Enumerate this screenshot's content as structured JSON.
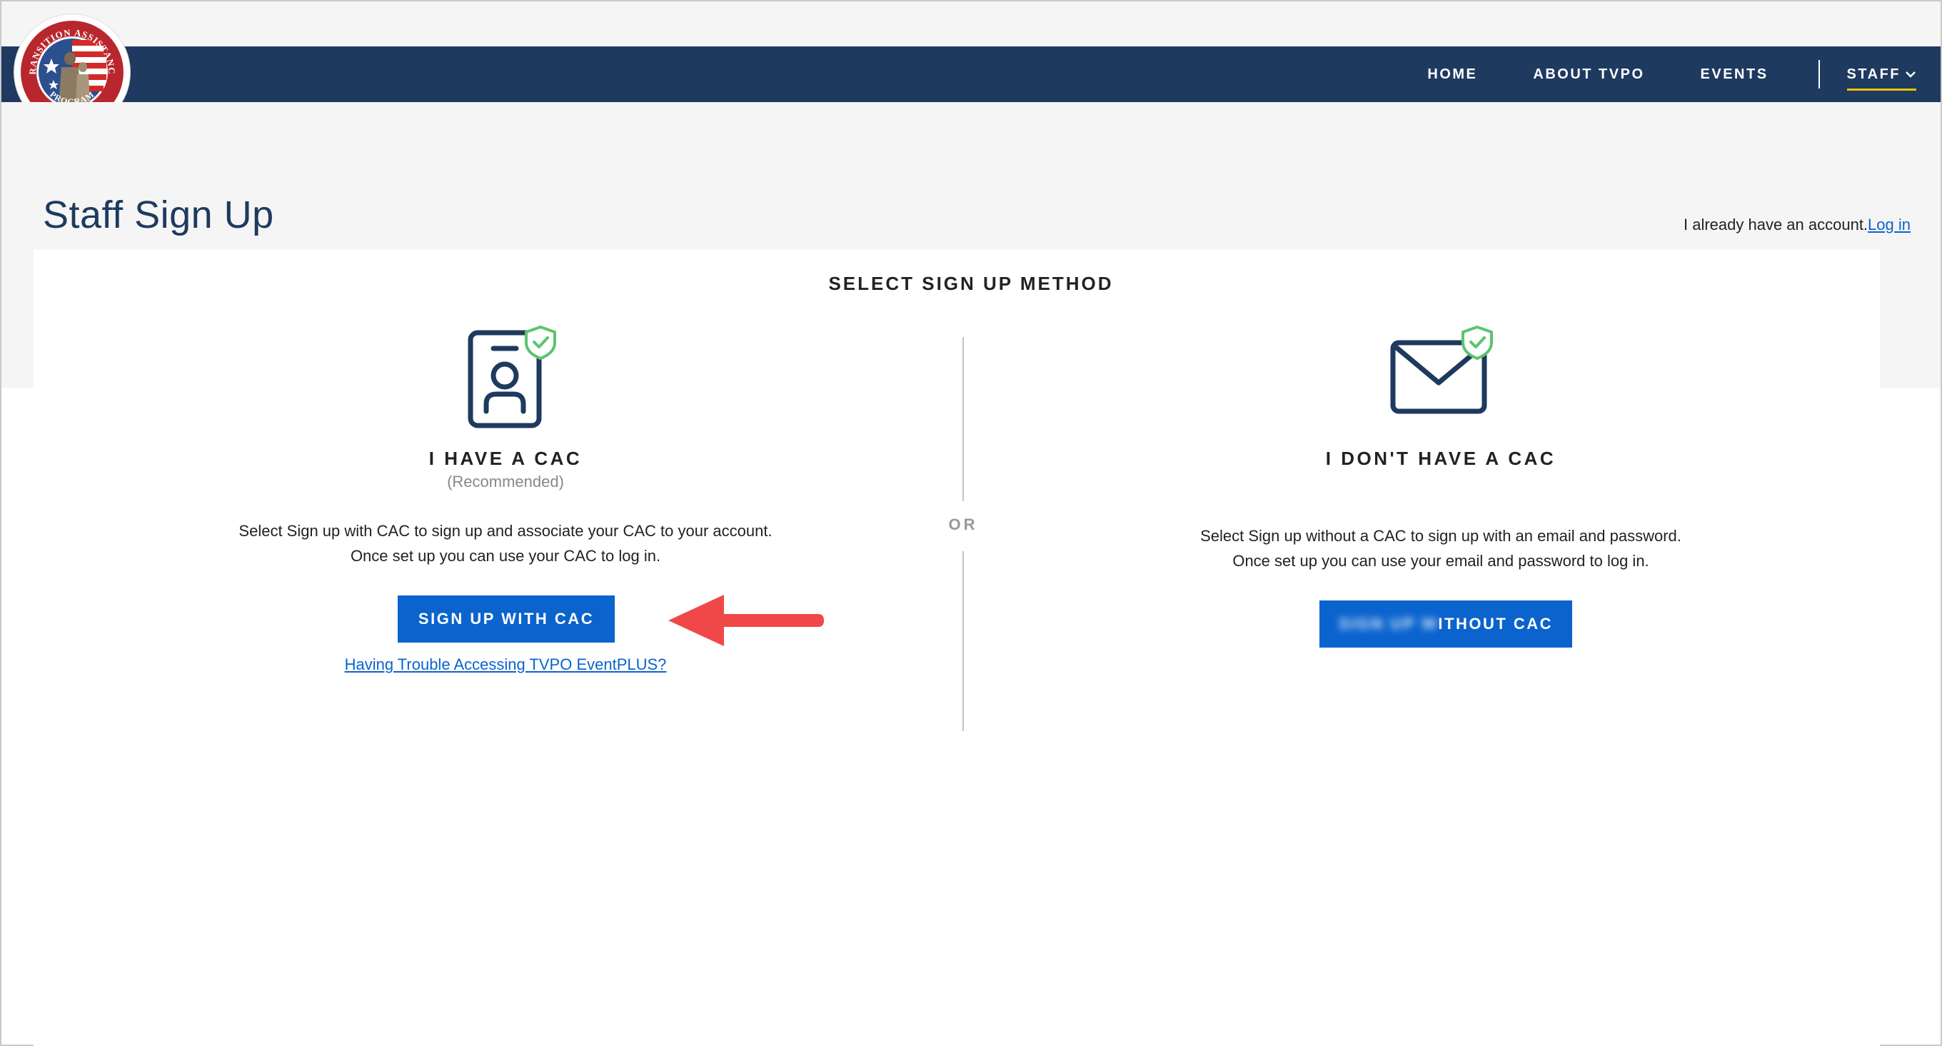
{
  "nav": {
    "items": [
      "HOME",
      "ABOUT TVPO",
      "EVENTS"
    ],
    "staff_label": "STAFF"
  },
  "logo": {
    "text_top": "TRANSITION ASSISTANCE",
    "text_bottom": "PROGRAM"
  },
  "page": {
    "title": "Staff Sign Up",
    "login_prompt": "I already have an account.",
    "login_link": "Log in"
  },
  "section_heading": "SELECT SIGN UP METHOD",
  "divider_label": "OR",
  "cac_option": {
    "icon": "id-badge-check-icon",
    "title": "I HAVE A CAC",
    "subtitle": "(Recommended)",
    "desc_line1": "Select Sign up with CAC to sign up and associate your CAC to your account.",
    "desc_line2": "Once set up you can use your CAC to log in.",
    "button": "SIGN UP WITH CAC",
    "help_link": "Having Trouble Accessing TVPO EventPLUS?"
  },
  "no_cac_option": {
    "icon": "envelope-check-icon",
    "title": "I DON'T HAVE A CAC",
    "desc_line1": "Select Sign up without a CAC to sign up with an email and password.",
    "desc_line2": "Once set up you can use your email and password to log in.",
    "button_blurred": "SIGN UP W",
    "button_visible": "ITHOUT CAC"
  },
  "colors": {
    "navbar": "#1e3a5f",
    "primary_button": "#0b63ce",
    "accent_underline": "#f2c200",
    "check_green": "#5cc46e",
    "annotation_arrow": "#f04848"
  }
}
